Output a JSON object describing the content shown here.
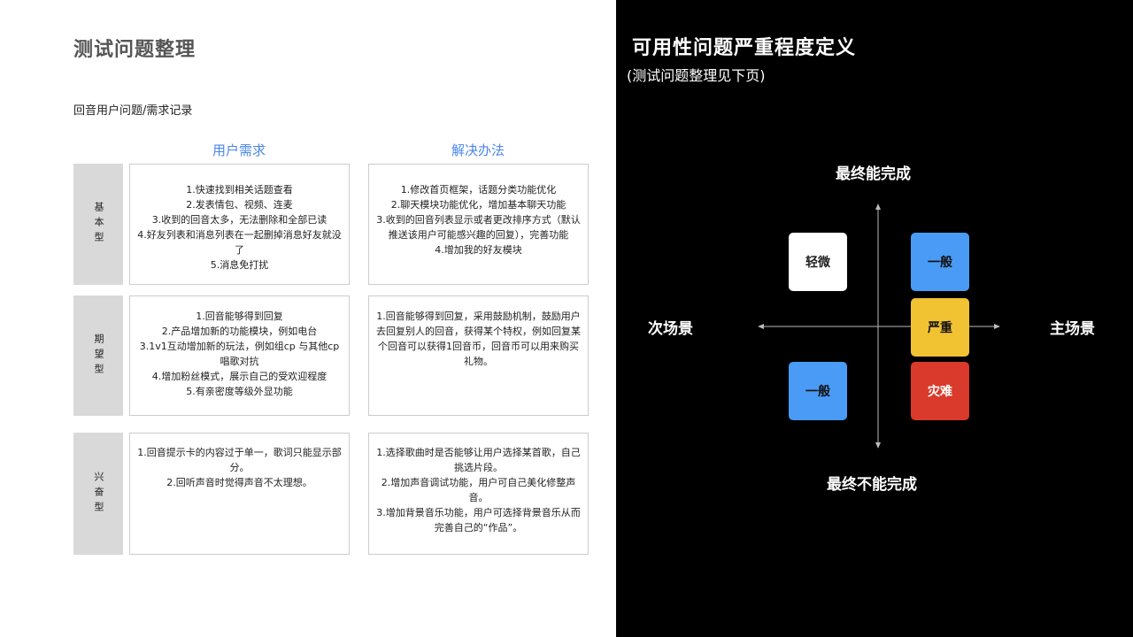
{
  "left": {
    "title": "测试问题整理",
    "subtitle": "回音用户问题/需求记录",
    "column_headers": {
      "needs": "用户需求",
      "solutions": "解决办法"
    },
    "rows": [
      {
        "label": "基本型",
        "needs": [
          "1.快速找到相关话题查看",
          "2.发表情包、视频、连麦",
          "3.收到的回音太多，无法删除和全部已读",
          "4.好友列表和消息列表在一起删掉消息好友就没了",
          "5.消息免打扰"
        ],
        "solutions": [
          "1.修改首页框架，话题分类功能优化",
          "2.聊天模块功能优化，增加基本聊天功能",
          "3.收到的回音列表显示或者更改排序方式（默认推送该用户可能感兴趣的回复），完善功能",
          "4.增加我的好友模块"
        ]
      },
      {
        "label": "期望型",
        "needs": [
          "1.回音能够得到回复",
          "2.产品增加新的功能模块，例如电台",
          "3.1v1互动增加新的玩法，例如组cp 与其他cp唱歌对抗",
          "4.增加粉丝模式，展示自己的受欢迎程度",
          "5.有亲密度等级外显功能"
        ],
        "solutions": [
          "1.回音能够得到回复，采用鼓励机制，鼓励用户去回复别人的回音，获得某个特权，例如回复某个回音可以获得1回音币，回音币可以用来购买礼物。"
        ]
      },
      {
        "label": "兴奋型",
        "needs": [
          "1.回音提示卡的内容过于单一，歌词只能显示部分。",
          "2.回听声音时觉得声音不太理想。"
        ],
        "solutions": [
          "1.选择歌曲时是否能够让用户选择某首歌，自己挑选片段。",
          "2.增加声音调试功能，用户可自己美化修整声音。",
          "3.增加背景音乐功能，用户可选择背景音乐从而完善自己的“作品”。"
        ]
      }
    ]
  },
  "right": {
    "title": "可用性问题严重程度定义",
    "subtitle": "(测试问题整理见下页)",
    "axes": {
      "top": "最终能完成",
      "bottom": "最终不能完成",
      "left": "次场景",
      "right": "主场景"
    },
    "boxes": {
      "light": {
        "label": "轻微",
        "color": "#ffffff"
      },
      "general_top": {
        "label": "一般",
        "color": "#4a9bf5"
      },
      "severe": {
        "label": "严重",
        "color": "#f1c232"
      },
      "general_bottom": {
        "label": "一般",
        "color": "#4a9bf5"
      },
      "disaster": {
        "label": "灾难",
        "color": "#d93a2b"
      }
    }
  }
}
